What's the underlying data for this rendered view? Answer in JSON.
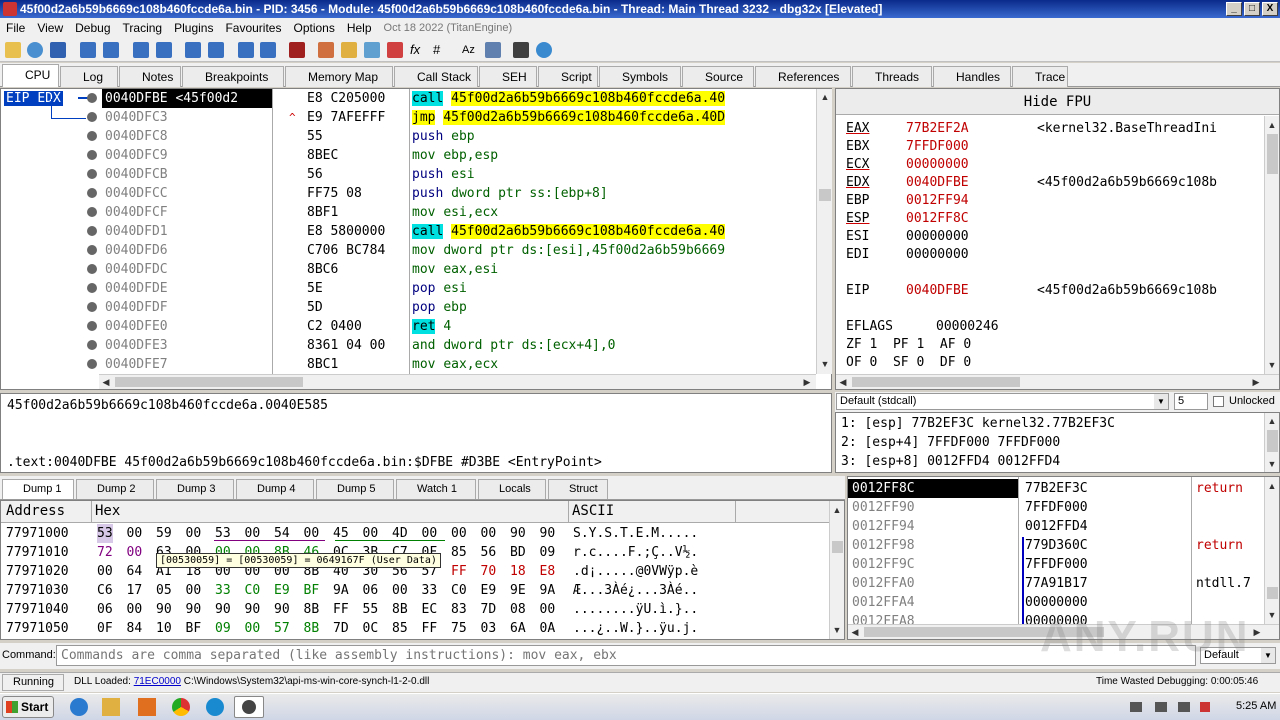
{
  "window": {
    "title": "45f00d2a6b59b6669c108b460fccde6a.bin - PID: 3456 - Module: 45f00d2a6b59b6669c108b460fccde6a.bin - Thread: Main Thread 3232 - dbg32x [Elevated]",
    "min": "_",
    "max": "□",
    "close": "X"
  },
  "menu": [
    "File",
    "View",
    "Debug",
    "Tracing",
    "Plugins",
    "Favourites",
    "Options",
    "Help"
  ],
  "menu_date": "Oct 18 2022 (TitanEngine)",
  "tabs": [
    {
      "label": "CPU",
      "color": "#5a8a3a"
    },
    {
      "label": "Log",
      "color": "#888"
    },
    {
      "label": "Notes",
      "color": "#888"
    },
    {
      "label": "Breakpoints",
      "color": "#d22"
    },
    {
      "label": "Memory Map",
      "color": "#3a7a3a"
    },
    {
      "label": "Call Stack",
      "color": "#3050b0"
    },
    {
      "label": "SEH",
      "color": "#666"
    },
    {
      "label": "Script",
      "color": "#666"
    },
    {
      "label": "Symbols",
      "color": "#a050c0"
    },
    {
      "label": "Source",
      "color": "#666"
    },
    {
      "label": "References",
      "color": "#666"
    },
    {
      "label": "Threads",
      "color": "#3060b0"
    },
    {
      "label": "Handles",
      "color": "#c03030"
    },
    {
      "label": "Trace",
      "color": "#666"
    }
  ],
  "labels": {
    "eip": "EIP",
    "edx": "EDX"
  },
  "disasm": [
    {
      "addr": "0040DFBE",
      "label": "<45f00d2",
      "bytes": "E8 C205000",
      "jmp": "",
      "instr_kw": "call",
      "instr_rest": "45f00d2a6b59b6669c108b460fccde6a.40",
      "kwclass": "hl-c",
      "restclass": "hl-y",
      "selected": true
    },
    {
      "addr": "0040DFC3",
      "label": "",
      "bytes": "E9 7AFEFFF",
      "jmp": "^",
      "instr_kw": "jmp",
      "instr_rest": "45f00d2a6b59b6669c108b460fccde6a.40D",
      "kwclass": "hl-y",
      "restclass": "hl-y"
    },
    {
      "addr": "0040DFC8",
      "label": "",
      "bytes": "55",
      "jmp": "",
      "instr_kw": "push",
      "instr_rest": "ebp",
      "kwclass": "c-blue",
      "restclass": "c-green"
    },
    {
      "addr": "0040DFC9",
      "label": "",
      "bytes": "8BEC",
      "jmp": "",
      "instr_kw": "mov",
      "instr_rest": "ebp,esp",
      "kwclass": "c-green",
      "restclass": "c-green"
    },
    {
      "addr": "0040DFCB",
      "label": "",
      "bytes": "56",
      "jmp": "",
      "instr_kw": "push",
      "instr_rest": "esi",
      "kwclass": "c-blue",
      "restclass": "c-green"
    },
    {
      "addr": "0040DFCC",
      "label": "",
      "bytes": "FF75 08",
      "jmp": "",
      "instr_kw": "push",
      "instr_rest": "dword ptr ss:[ebp+8]",
      "kwclass": "c-blue",
      "restclass": "c-green"
    },
    {
      "addr": "0040DFCF",
      "label": "",
      "bytes": "8BF1",
      "jmp": "",
      "instr_kw": "mov",
      "instr_rest": "esi,ecx",
      "kwclass": "c-green",
      "restclass": "c-green"
    },
    {
      "addr": "0040DFD1",
      "label": "",
      "bytes": "E8 5800000",
      "jmp": "",
      "instr_kw": "call",
      "instr_rest": "45f00d2a6b59b6669c108b460fccde6a.40",
      "kwclass": "hl-c",
      "restclass": "hl-y"
    },
    {
      "addr": "0040DFD6",
      "label": "",
      "bytes": "C706 BC784",
      "jmp": "",
      "instr_kw": "mov",
      "instr_rest": "dword ptr ds:[esi],45f00d2a6b59b6669",
      "kwclass": "c-green",
      "restclass": "c-green"
    },
    {
      "addr": "0040DFDC",
      "label": "",
      "bytes": "8BC6",
      "jmp": "",
      "instr_kw": "mov",
      "instr_rest": "eax,esi",
      "kwclass": "c-green",
      "restclass": "c-green"
    },
    {
      "addr": "0040DFDE",
      "label": "",
      "bytes": "5E",
      "jmp": "",
      "instr_kw": "pop",
      "instr_rest": "esi",
      "kwclass": "c-blue",
      "restclass": "c-green"
    },
    {
      "addr": "0040DFDF",
      "label": "",
      "bytes": "5D",
      "jmp": "",
      "instr_kw": "pop",
      "instr_rest": "ebp",
      "kwclass": "c-blue",
      "restclass": "c-green"
    },
    {
      "addr": "0040DFE0",
      "label": "",
      "bytes": "C2 0400",
      "jmp": "",
      "instr_kw": "ret",
      "instr_rest": "4",
      "kwclass": "hl-c",
      "restclass": "c-green"
    },
    {
      "addr": "0040DFE3",
      "label": "",
      "bytes": "8361 04 00",
      "jmp": "",
      "instr_kw": "and",
      "instr_rest": "dword ptr ds:[ecx+4],0",
      "kwclass": "c-green",
      "restclass": "c-green"
    },
    {
      "addr": "0040DFE7",
      "label": "",
      "bytes": "8BC1",
      "jmp": "",
      "instr_kw": "mov",
      "instr_rest": "eax,ecx",
      "kwclass": "c-green",
      "restclass": "c-green"
    }
  ],
  "fpu_header": "Hide FPU",
  "registers": [
    {
      "name": "EAX",
      "val": "77B2EF2A",
      "info": "<kernel32.BaseThreadIni",
      "changed": true,
      "ul": true
    },
    {
      "name": "EBX",
      "val": "7FFDF000",
      "info": "",
      "changed": true,
      "ul": false
    },
    {
      "name": "ECX",
      "val": "00000000",
      "info": "",
      "changed": true,
      "ul": true
    },
    {
      "name": "EDX",
      "val": "0040DFBE",
      "info": "<45f00d2a6b59b6669c108b",
      "changed": true,
      "ul": true
    },
    {
      "name": "EBP",
      "val": "0012FF94",
      "info": "",
      "changed": true,
      "ul": false
    },
    {
      "name": "ESP",
      "val": "0012FF8C",
      "info": "",
      "changed": true,
      "ul": true
    },
    {
      "name": "ESI",
      "val": "00000000",
      "info": "",
      "changed": false,
      "ul": false
    },
    {
      "name": "EDI",
      "val": "00000000",
      "info": "",
      "changed": false,
      "ul": false
    }
  ],
  "eip_reg": {
    "name": "EIP",
    "val": "0040DFBE",
    "info": "<45f00d2a6b59b6669c108b"
  },
  "eflags": {
    "name": "EFLAGS",
    "val": "00000246"
  },
  "flags_line1": "ZF 1  PF 1  AF 0",
  "flags_line2": "OF 0  SF 0  DF 0",
  "callconv": "Default (stdcall)",
  "argcount": "5",
  "unlocked": "Unlocked",
  "args": [
    "1: [esp] 77B2EF3C kernel32.77B2EF3C",
    "2: [esp+4] 7FFDF000 7FFDF000",
    "3: [esp+8] 0012FFD4 0012FFD4"
  ],
  "info_line1": "45f00d2a6b59b6669c108b460fccde6a.0040E585",
  "info_line2": ".text:0040DFBE 45f00d2a6b59b6669c108b460fccde6a.bin:$DFBE #D3BE <EntryPoint>",
  "dump_tabs": [
    "Dump 1",
    "Dump 2",
    "Dump 3",
    "Dump 4",
    "Dump 5",
    "Watch 1",
    "Locals",
    "Struct"
  ],
  "dump_headers": {
    "address": "Address",
    "hex": "Hex",
    "ascii": "ASCII"
  },
  "dump_rows": [
    {
      "addr": "77971000",
      "hex": [
        "53",
        "00",
        "59",
        "00",
        "53",
        "00",
        "54",
        "00",
        "45",
        "00",
        "4D",
        "00",
        "00",
        "00",
        "90",
        "90"
      ],
      "ascii": "S.Y.S.T.E.M....."
    },
    {
      "addr": "77971010",
      "hex": [
        "72",
        "00",
        "63",
        "00",
        "00",
        "00",
        "8B",
        "46",
        "0C",
        "3B",
        "C7",
        "0F",
        "85",
        "56",
        "BD",
        "09"
      ],
      "ascii": "r.c....F.;Ç..V½."
    },
    {
      "addr": "77971020",
      "hex": [
        "00",
        "64",
        "A1",
        "18",
        "00",
        "00",
        "00",
        "8B",
        "40",
        "30",
        "56",
        "57",
        "FF",
        "70",
        "18",
        "E8"
      ],
      "ascii": ".d¡.....@0VWÿp.è"
    },
    {
      "addr": "77971030",
      "hex": [
        "C6",
        "17",
        "05",
        "00",
        "33",
        "C0",
        "E9",
        "BF",
        "9A",
        "06",
        "00",
        "33",
        "C0",
        "E9",
        "9E",
        "9A"
      ],
      "ascii": "Æ...3Àé¿...3Àé.."
    },
    {
      "addr": "77971040",
      "hex": [
        "06",
        "00",
        "90",
        "90",
        "90",
        "90",
        "90",
        "8B",
        "FF",
        "55",
        "8B",
        "EC",
        "83",
        "7D",
        "08",
        "00"
      ],
      "ascii": "........ÿU.ì.}.."
    },
    {
      "addr": "77971050",
      "hex": [
        "0F",
        "84",
        "10",
        "BF",
        "09",
        "00",
        "57",
        "8B",
        "7D",
        "0C",
        "85",
        "FF",
        "75",
        "03",
        "6A",
        "0A"
      ],
      "ascii": "...¿..W.}..ÿu.j."
    }
  ],
  "tooltip": "[00530059] = [00530059] = 0649167F (User Data)",
  "stack": [
    {
      "addr": "0012FF8C",
      "val": "77B2EF3C",
      "comment": "return",
      "sel": true
    },
    {
      "addr": "0012FF90",
      "val": "7FFDF000",
      "comment": ""
    },
    {
      "addr": "0012FF94",
      "val": "0012FFD4",
      "comment": ""
    },
    {
      "addr": "0012FF98",
      "val": "779D360C",
      "comment": "return"
    },
    {
      "addr": "0012FF9C",
      "val": "7FFDF000",
      "comment": ""
    },
    {
      "addr": "0012FFA0",
      "val": "77A91B17",
      "comment": "ntdll.7"
    },
    {
      "addr": "0012FFA4",
      "val": "00000000",
      "comment": ""
    },
    {
      "addr": "0012FFA8",
      "val": "00000000",
      "comment": ""
    }
  ],
  "command": {
    "label": "Command:",
    "placeholder": "Commands are comma separated (like assembly instructions): mov eax, ebx",
    "mode": "Default"
  },
  "status": {
    "state": "Running",
    "dll_prefix": "DLL Loaded: ",
    "dll_addr": "71EC0000",
    "dll_path": " C:\\Windows\\System32\\api-ms-win-core-synch-l1-2-0.dll",
    "time": "Time Wasted Debugging: 0:00:05:46"
  },
  "taskbar": {
    "start": "Start",
    "clock": "5:25 AM"
  },
  "watermark": "ANY.RUN"
}
